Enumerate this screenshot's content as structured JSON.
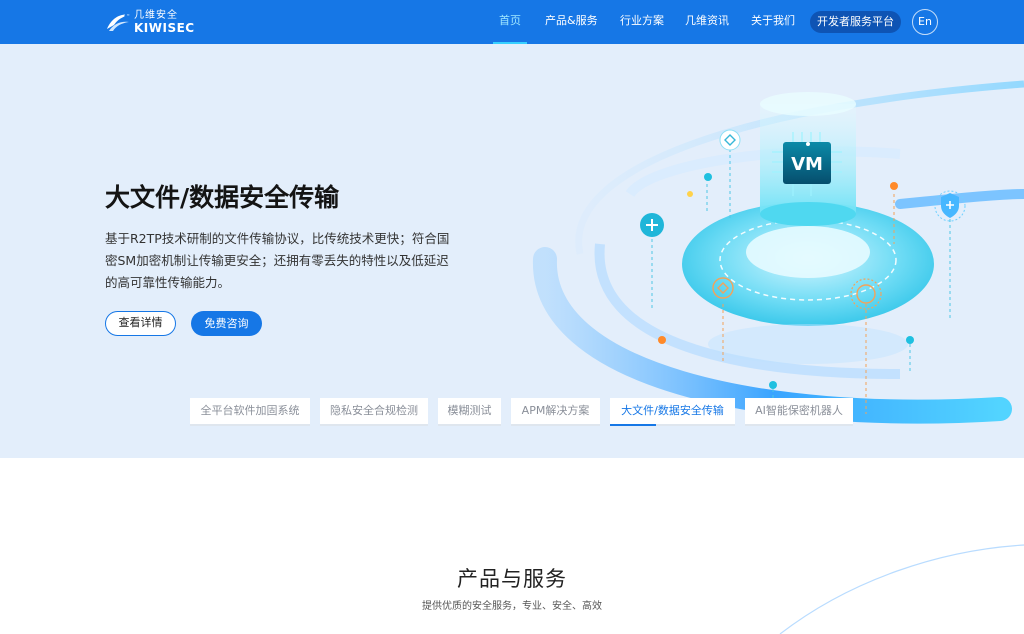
{
  "header": {
    "logo_cn": "几维安全",
    "logo_en": "KIWISEC",
    "nav": [
      {
        "label": "首页",
        "active": true
      },
      {
        "label": "产品&服务",
        "active": false
      },
      {
        "label": "行业方案",
        "active": false
      },
      {
        "label": "几维资讯",
        "active": false
      },
      {
        "label": "关于我们",
        "active": false
      }
    ],
    "dev_platform": "开发者服务平台",
    "lang": "En"
  },
  "hero": {
    "title": "大文件/数据安全传输",
    "description": "基于R2TP技术研制的文件传输协议，比传统技术更快；符合国密SM加密机制让传输更安全；还拥有零丢失的特性以及低延迟的高可靠性传输能力。",
    "btn_detail": "查看详情",
    "btn_consult": "免费咨询",
    "illustration_label": "VM",
    "tabs": [
      {
        "label": "全平台软件加固系统",
        "active": false
      },
      {
        "label": "隐私安全合规检测",
        "active": false
      },
      {
        "label": "模糊测试",
        "active": false
      },
      {
        "label": "APM解决方案",
        "active": false
      },
      {
        "label": "大文件/数据安全传输",
        "active": true
      },
      {
        "label": "AI智能保密机器人",
        "active": false
      }
    ]
  },
  "section": {
    "title": "产品与服务",
    "subtitle": "提供优质的安全服务，专业、安全、高效"
  },
  "colors": {
    "primary": "#1677e6",
    "nav_active": "#9fe6ff",
    "dev_button": "#0e54b4",
    "hero_bg": "#e3eefb"
  }
}
